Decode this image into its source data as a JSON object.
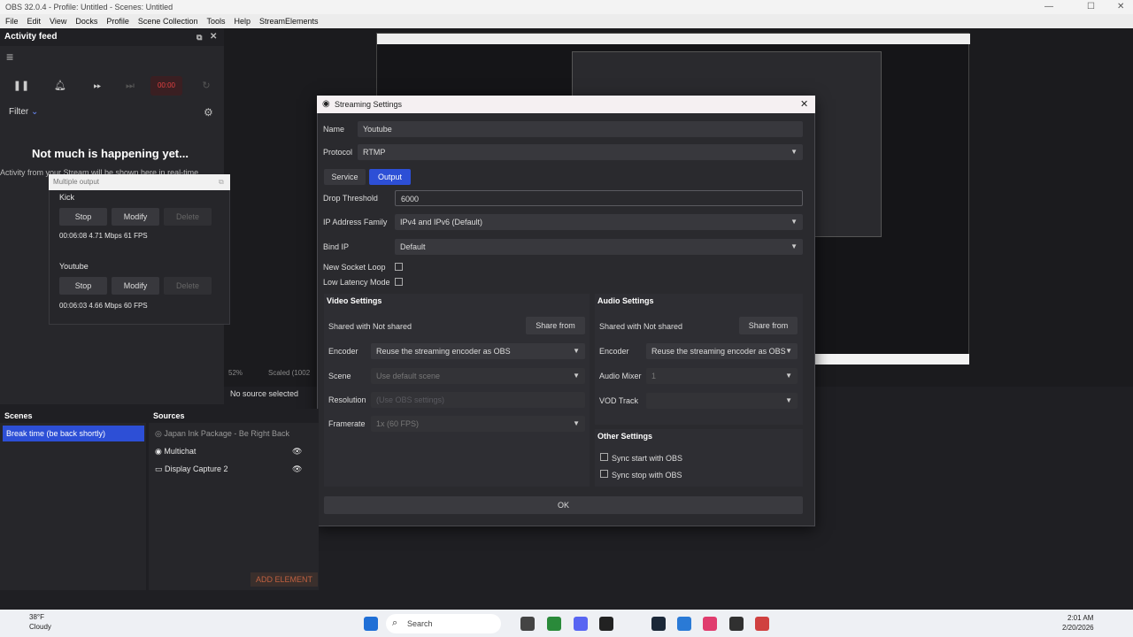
{
  "window": {
    "title": "OBS 32.0.4 - Profile: Untitled - Scenes: Untitled"
  },
  "menu": [
    "File",
    "Edit",
    "View",
    "Docks",
    "Profile",
    "Scene Collection",
    "Tools",
    "Help",
    "StreamElements"
  ],
  "activity": {
    "title": "Activity feed",
    "timer": "00:00",
    "filter_label": "Filter",
    "empty_title": "Not much is happening yet...",
    "empty_sub": "Activity from your Stream will be shown here in real-time"
  },
  "multi_output": {
    "title": "Multiple output",
    "targets": [
      {
        "name": "Kick",
        "stop": "Stop",
        "modify": "Modify",
        "delete": "Delete",
        "stats": "00:06:08  4.71 Mbps  61 FPS"
      },
      {
        "name": "Youtube",
        "stop": "Stop",
        "modify": "Modify",
        "delete": "Delete",
        "stats": "00:06:03  4.66 Mbps  60 FPS"
      }
    ]
  },
  "preview": {
    "zoom": "52%",
    "scaled": "Scaled (1002",
    "no_source": "No source selected"
  },
  "dialog": {
    "title": "Streaming Settings",
    "name_label": "Name",
    "name_value": "Youtube",
    "protocol_label": "Protocol",
    "protocol_value": "RTMP",
    "tab_service": "Service",
    "tab_output": "Output",
    "drop_label": "Drop Threshold",
    "drop_value": "6000",
    "ipfam_label": "IP Address Family",
    "ipfam_value": "IPv4 and IPv6 (Default)",
    "bindip_label": "Bind IP",
    "bindip_value": "Default",
    "newsock_label": "New Socket Loop",
    "lowlat_label": "Low Latency Mode",
    "video": {
      "title": "Video Settings",
      "shared": "Shared with Not shared",
      "share_btn": "Share from",
      "encoder_label": "Encoder",
      "encoder_value": "Reuse the streaming encoder as OBS",
      "scene_label": "Scene",
      "scene_value": "Use default scene",
      "res_label": "Resolution",
      "res_value": "(Use OBS settings)",
      "fr_label": "Framerate",
      "fr_value": "1x (60 FPS)"
    },
    "audio": {
      "title": "Audio Settings",
      "shared": "Shared with Not shared",
      "share_btn": "Share from",
      "encoder_label": "Encoder",
      "encoder_value": "Reuse the streaming encoder as OBS",
      "mixer_label": "Audio Mixer",
      "mixer_value": "1",
      "vod_label": "VOD Track",
      "vod_value": ""
    },
    "other": {
      "title": "Other Settings",
      "sync_start": "Sync start with OBS",
      "sync_stop": "Sync stop with OBS"
    },
    "ok": "OK"
  },
  "scenes": {
    "title": "Scenes",
    "items": [
      "Break time (be back shortly)"
    ]
  },
  "sources": {
    "title": "Sources",
    "items": [
      "Japan Ink Package - Be Right Back",
      "Multichat",
      "Display Capture 2"
    ],
    "add": "ADD ELEMENT"
  },
  "taskbar": {
    "temp": "38°F",
    "weather": "Cloudy",
    "search": "Search",
    "time": "2:01 AM",
    "date": "2/20/2026"
  },
  "colors": {
    "accent": "#2d4fd6",
    "record": "#e04040"
  }
}
